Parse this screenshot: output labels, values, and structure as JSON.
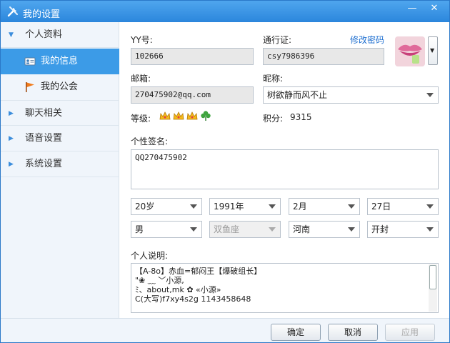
{
  "window": {
    "title": "我的设置",
    "minimize_glyph": "—",
    "close_glyph": "✕"
  },
  "sidebar": {
    "sections": [
      {
        "label": "个人资料",
        "expanded": true
      },
      {
        "label": "聊天相关",
        "expanded": false
      },
      {
        "label": "语音设置",
        "expanded": false
      },
      {
        "label": "系统设置",
        "expanded": false
      }
    ],
    "sub_items": [
      {
        "label": "我的信息",
        "icon": "id-card-icon",
        "active": true
      },
      {
        "label": "我的公会",
        "icon": "flag-icon",
        "active": false
      }
    ],
    "expanded_arrow": "▼",
    "collapsed_arrow": "▶"
  },
  "profile": {
    "yy_label": "YY号:",
    "yy_value": "102666",
    "passport_label": "通行证:",
    "passport_value": "csy7986396",
    "change_password": "修改密码",
    "email_label": "邮箱:",
    "email_value": "270475902@qq.com",
    "nickname_label": "昵称:",
    "nickname_value": "树欲静而风不止",
    "level_label": "等级:",
    "level_icons": [
      "crown-icon",
      "crown-icon",
      "crown-icon",
      "clover-icon"
    ],
    "points_label": "积分:",
    "points_value": "9315",
    "signature_label": "个性签名:",
    "signature_value": "QQ270475902",
    "age": "20岁",
    "birth_year": "1991年",
    "birth_month": "2月",
    "birth_day": "27日",
    "gender": "男",
    "zodiac": "双鱼座",
    "province": "河南",
    "city": "开封",
    "description_label": "个人说明:",
    "description_lines": [
      "【A-8o】赤血=郁闷王【爆破组长】",
      "  \"❀    ﹏      ﹀小源,",
      "  ﾐ、about,mk ✿ «小源»",
      "C(大写)f7xy4s2g  1143458648"
    ]
  },
  "buttons": {
    "ok": "确定",
    "cancel": "取消",
    "apply": "应用"
  },
  "colors": {
    "title_bar": "#2b86dc",
    "active_item": "#3c9be7",
    "link": "#1e6fd0"
  }
}
